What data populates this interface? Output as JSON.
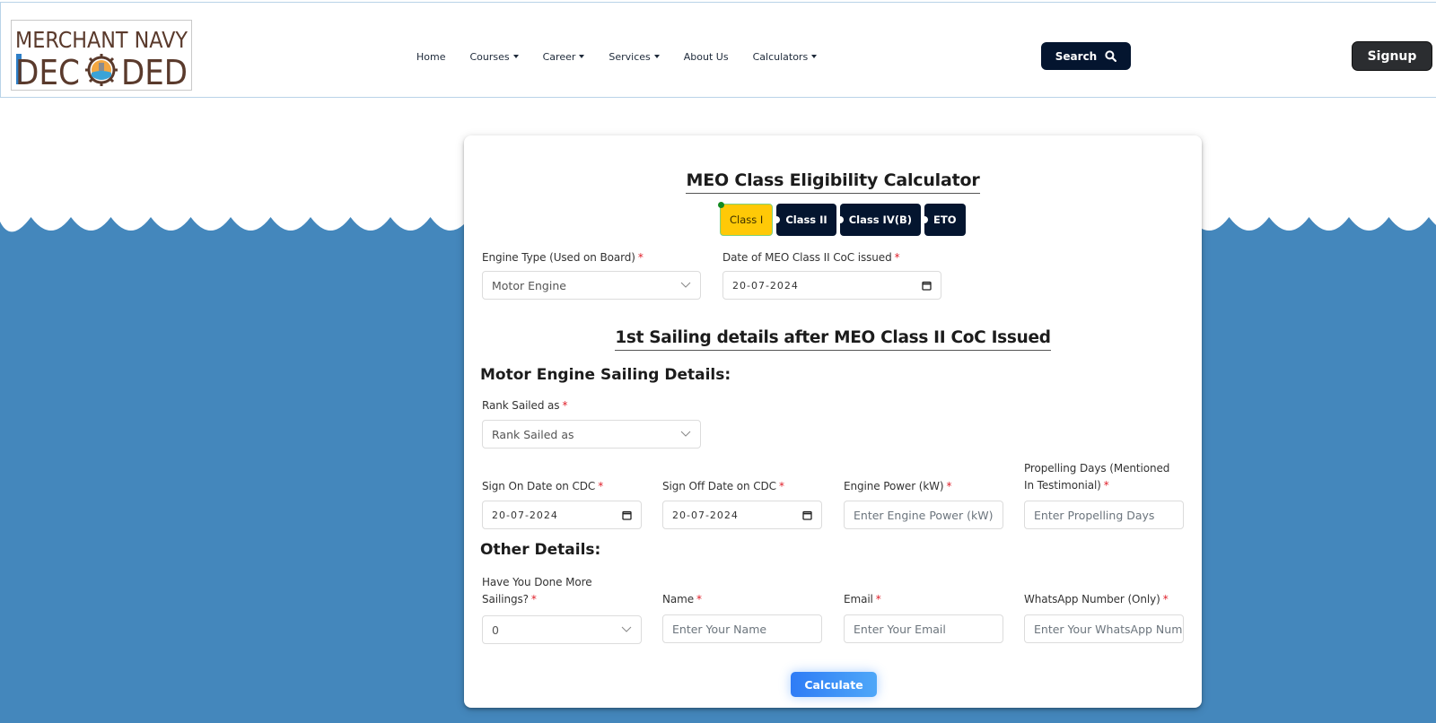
{
  "header": {
    "logo": {
      "line1": "MERCHANT NAVY",
      "line2_left": "DEC",
      "line2_right": "DED",
      "alt": "Merchant Navy Decoded"
    },
    "nav": [
      {
        "label": "Home",
        "has_dropdown": false
      },
      {
        "label": "Courses",
        "has_dropdown": true
      },
      {
        "label": "Career",
        "has_dropdown": true
      },
      {
        "label": "Services",
        "has_dropdown": true
      },
      {
        "label": "About Us",
        "has_dropdown": false
      },
      {
        "label": "Calculators",
        "has_dropdown": true
      }
    ],
    "search_label": "Search",
    "signup_label": "Signup"
  },
  "colors": {
    "ocean": "#4487bc",
    "navy": "#04152f",
    "active_tab": "#ffc907",
    "required": "#e0202a",
    "calc_gradient_start": "#2f7cf6",
    "calc_gradient_end": "#4ea7f8"
  },
  "calculator": {
    "title": "MEO Class Eligibility Calculator",
    "class_tabs": [
      {
        "label": "Class I",
        "active": true
      },
      {
        "label": "Class II",
        "active": false
      },
      {
        "label": "Class IV(B)",
        "active": false
      },
      {
        "label": "ETO",
        "active": false
      }
    ],
    "engine_type": {
      "label": "Engine Type (Used on Board)",
      "required_mark": "*",
      "value": "Motor Engine"
    },
    "coc_date": {
      "label": "Date of MEO Class II CoC issued",
      "required_mark": "*",
      "value": "20-07-2024"
    },
    "section_title": "1st Sailing details after MEO Class II CoC Issued",
    "motor_heading": "Motor Engine Sailing Details:",
    "rank": {
      "label": "Rank Sailed as",
      "required_mark": "*",
      "value": "Rank Sailed as"
    },
    "sign_on": {
      "label": "Sign On Date on CDC",
      "required_mark": "*",
      "value": "20-07-2024"
    },
    "sign_off": {
      "label": "Sign Off Date on CDC",
      "required_mark": "*",
      "value": "20-07-2024"
    },
    "engine_power": {
      "label": "Engine Power (kW)",
      "required_mark": "*",
      "placeholder": "Enter Engine Power (kW)"
    },
    "propelling_days": {
      "label_line1": "Propelling Days (Mentioned",
      "label_line2": "In Testimonial)",
      "required_mark": "*",
      "placeholder": "Enter Propelling Days"
    },
    "other_heading": "Other Details:",
    "more_sailings": {
      "label_line1": "Have You Done More",
      "label_line2": "Sailings?",
      "required_mark": "*",
      "value": "0"
    },
    "name": {
      "label": "Name",
      "required_mark": "*",
      "placeholder": "Enter Your Name"
    },
    "email": {
      "label": "Email",
      "required_mark": "*",
      "placeholder": "Enter Your Email"
    },
    "whatsapp": {
      "label": "WhatsApp Number (Only)",
      "required_mark": "*",
      "placeholder": "Enter Your WhatsApp Number"
    },
    "calculate_label": "Calculate"
  }
}
